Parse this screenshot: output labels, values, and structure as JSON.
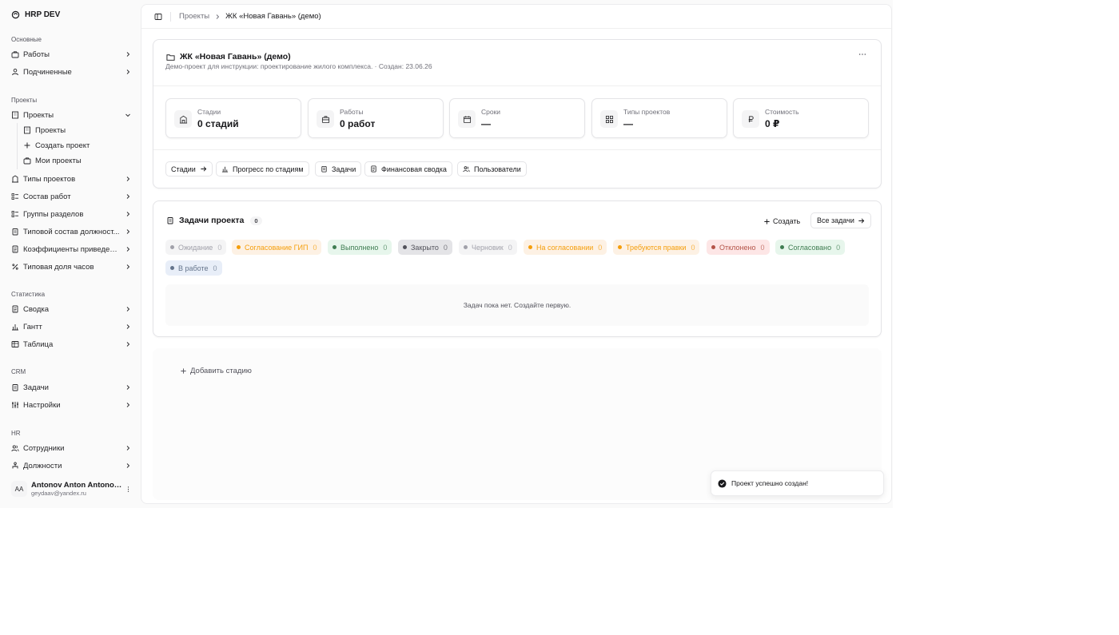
{
  "app": {
    "brand": "HRP DEV"
  },
  "sidebar": {
    "sections": {
      "main": "Основные",
      "projects": "Проекты",
      "stats": "Статистика",
      "crm": "CRM",
      "hr": "HR"
    },
    "items": {
      "works": "Работы",
      "subordinates": "Подчиненные",
      "projects": "Проекты",
      "project_types": "Типы проектов",
      "work_composition": "Состав работ",
      "section_groups": "Группы разделов",
      "typical_positions": "Типовой состав должност...",
      "coefficients": "Коэффициенты приведени...",
      "typical_hours": "Типовая доля часов",
      "summary": "Сводка",
      "gantt": "Гантт",
      "table": "Таблица",
      "tasks": "Задачи",
      "settings": "Настройки",
      "employees": "Сотрудники",
      "positions": "Должности"
    },
    "sub_items": {
      "projects": "Проекты",
      "create_project": "Создать проект",
      "my_projects": "Мои проекты"
    },
    "user": {
      "initials": "AA",
      "name": "Antonov Anton Antonovi...",
      "email": "geydaav@yandex.ru"
    }
  },
  "breadcrumb": {
    "parent": "Проекты",
    "current": "ЖК «Новая Гавань» (демо)"
  },
  "project": {
    "title": "ЖК «Новая Гавань» (демо)",
    "description": "Демо-проект для инструкции: проектирование жилого комплекса. · Создан: 23.06.26"
  },
  "stats": [
    {
      "label": "Стадии",
      "value": "0 стадий",
      "icon": "building-icon"
    },
    {
      "label": "Работы",
      "value": "0 работ",
      "icon": "briefcase-icon"
    },
    {
      "label": "Сроки",
      "value": "—",
      "icon": "calendar-icon"
    },
    {
      "label": "Типы проектов",
      "value": "—",
      "icon": "grid-icon"
    },
    {
      "label": "Стоимость",
      "value": "0 ₽",
      "icon": "ruble-icon"
    }
  ],
  "actions": {
    "stages": "Стадии",
    "progress": "Прогресс по стадиям",
    "tasks": "Задачи",
    "finance": "Финансовая сводка",
    "users": "Пользователи"
  },
  "tasks": {
    "title": "Задачи проекта",
    "count": "0",
    "create": "Создать",
    "all": "Все задачи",
    "empty": "Задач пока нет. Создайте первую.",
    "statuses": [
      {
        "label": "Ожидание",
        "count": "0",
        "bg": "#f4f4f5",
        "fg": "#a1a1aa",
        "dot": "#a1a1aa"
      },
      {
        "label": "Согласование ГИП",
        "count": "0",
        "bg": "#fdf1e4",
        "fg": "#f59e0b",
        "dot": "#f59e0b"
      },
      {
        "label": "Выполнено",
        "count": "0",
        "bg": "#e7f6ec",
        "fg": "#3f7d52",
        "dot": "#3f7d52"
      },
      {
        "label": "Закрыто",
        "count": "0",
        "bg": "#e4e4e7",
        "fg": "#52525b",
        "dot": "#52525b"
      },
      {
        "label": "Черновик",
        "count": "0",
        "bg": "#f4f4f5",
        "fg": "#a1a1aa",
        "dot": "#a1a1aa"
      },
      {
        "label": "На согласовании",
        "count": "0",
        "bg": "#fdf1e4",
        "fg": "#f59e0b",
        "dot": "#f59e0b"
      },
      {
        "label": "Требуются правки",
        "count": "0",
        "bg": "#fdf1e4",
        "fg": "#f59e0b",
        "dot": "#f59e0b"
      },
      {
        "label": "Отклонено",
        "count": "0",
        "bg": "#fde6e6",
        "fg": "#b45348",
        "dot": "#b45348"
      },
      {
        "label": "Согласовано",
        "count": "0",
        "bg": "#e7f6ec",
        "fg": "#3f7d52",
        "dot": "#3f7d52"
      },
      {
        "label": "В работе",
        "count": "0",
        "bg": "#e8eef8",
        "fg": "#64748b",
        "dot": "#64748b"
      }
    ]
  },
  "stages": {
    "add": "Добавить стадию"
  },
  "toast": {
    "message": "Проект успешно создан!"
  }
}
